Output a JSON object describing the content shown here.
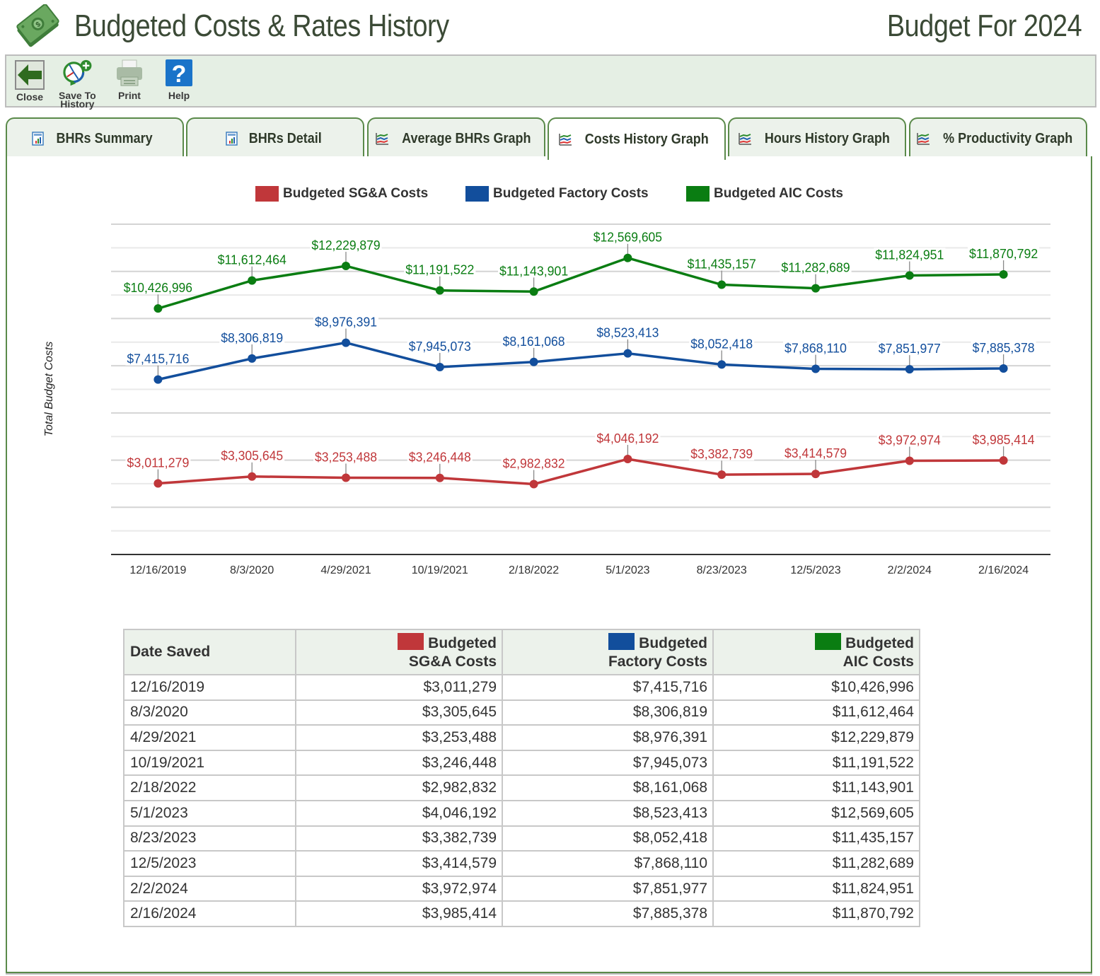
{
  "header": {
    "title": "Budgeted Costs & Rates History",
    "budget_year": "Budget For 2024",
    "logo_icon": "money-bills-icon"
  },
  "toolbar": {
    "close_label": "Close",
    "save_label_line1": "Save To",
    "save_label_line2": "History",
    "print_label": "Print",
    "help_label": "Help"
  },
  "tabs": [
    {
      "label": "BHRs Summary",
      "icon": "report-icon",
      "active": false
    },
    {
      "label": "BHRs Detail",
      "icon": "report-icon",
      "active": false
    },
    {
      "label": "Average BHRs Graph",
      "icon": "line-graph-icon",
      "active": false
    },
    {
      "label": "Costs History Graph",
      "icon": "line-graph-icon",
      "active": true
    },
    {
      "label": "Hours History Graph",
      "icon": "line-graph-icon",
      "active": false
    },
    {
      "label": "% Productivity Graph",
      "icon": "line-graph-icon",
      "active": false
    }
  ],
  "colors": {
    "sga": "#c0373a",
    "factory": "#124e9c",
    "aic": "#0a7d12",
    "tab_border": "#5a8a4a",
    "toolbar_bg": "#e5efe4"
  },
  "chart_data": {
    "type": "line",
    "title": "",
    "xlabel": "",
    "ylabel": "Total Budget Costs",
    "ylim": [
      0,
      14000000
    ],
    "y_grid_step": 1000000,
    "y_tick_labels_shown": false,
    "grid": true,
    "legend_position": "top",
    "categories": [
      "12/16/2019",
      "8/3/2020",
      "4/29/2021",
      "10/19/2021",
      "2/18/2022",
      "5/1/2023",
      "8/23/2023",
      "12/5/2023",
      "2/2/2024",
      "2/16/2024"
    ],
    "series": [
      {
        "key": "sga",
        "name": "Budgeted SG&A Costs",
        "color": "#c0373a",
        "values": [
          3011279,
          3305645,
          3253488,
          3246448,
          2982832,
          4046192,
          3382739,
          3414579,
          3972974,
          3985414
        ],
        "labels": [
          "$3,011,279",
          "$3,305,645",
          "$3,253,488",
          "$3,246,448",
          "$2,982,832",
          "$4,046,192",
          "$3,382,739",
          "$3,414,579",
          "$3,972,974",
          "$3,985,414"
        ]
      },
      {
        "key": "factory",
        "name": "Budgeted Factory Costs",
        "color": "#124e9c",
        "values": [
          7415716,
          8306819,
          8976391,
          7945073,
          8161068,
          8523413,
          8052418,
          7868110,
          7851977,
          7885378
        ],
        "labels": [
          "$7,415,716",
          "$8,306,819",
          "$8,976,391",
          "$7,945,073",
          "$8,161,068",
          "$8,523,413",
          "$8,052,418",
          "$7,868,110",
          "$7,851,977",
          "$7,885,378"
        ]
      },
      {
        "key": "aic",
        "name": "Budgeted AIC Costs",
        "color": "#0a7d12",
        "values": [
          10426996,
          11612464,
          12229879,
          11191522,
          11143901,
          12569605,
          11435157,
          11282689,
          11824951,
          11870792
        ],
        "labels": [
          "$10,426,996",
          "$11,612,464",
          "$12,229,879",
          "$11,191,522",
          "$11,143,901",
          "$12,569,605",
          "$11,435,157",
          "$11,282,689",
          "$11,824,951",
          "$11,870,792"
        ]
      }
    ]
  },
  "table": {
    "headers": {
      "date": "Date Saved",
      "sga_line1": "Budgeted",
      "sga_line2": "SG&A Costs",
      "factory_line1": "Budgeted",
      "factory_line2": "Factory Costs",
      "aic_line1": "Budgeted",
      "aic_line2": "AIC Costs"
    },
    "rows": [
      {
        "date": "12/16/2019",
        "sga": "$3,011,279",
        "factory": "$7,415,716",
        "aic": "$10,426,996"
      },
      {
        "date": "8/3/2020",
        "sga": "$3,305,645",
        "factory": "$8,306,819",
        "aic": "$11,612,464"
      },
      {
        "date": "4/29/2021",
        "sga": "$3,253,488",
        "factory": "$8,976,391",
        "aic": "$12,229,879"
      },
      {
        "date": "10/19/2021",
        "sga": "$3,246,448",
        "factory": "$7,945,073",
        "aic": "$11,191,522"
      },
      {
        "date": "2/18/2022",
        "sga": "$2,982,832",
        "factory": "$8,161,068",
        "aic": "$11,143,901"
      },
      {
        "date": "5/1/2023",
        "sga": "$4,046,192",
        "factory": "$8,523,413",
        "aic": "$12,569,605"
      },
      {
        "date": "8/23/2023",
        "sga": "$3,382,739",
        "factory": "$8,052,418",
        "aic": "$11,435,157"
      },
      {
        "date": "12/5/2023",
        "sga": "$3,414,579",
        "factory": "$7,868,110",
        "aic": "$11,282,689"
      },
      {
        "date": "2/2/2024",
        "sga": "$3,972,974",
        "factory": "$7,851,977",
        "aic": "$11,824,951"
      },
      {
        "date": "2/16/2024",
        "sga": "$3,985,414",
        "factory": "$7,885,378",
        "aic": "$11,870,792"
      }
    ]
  }
}
